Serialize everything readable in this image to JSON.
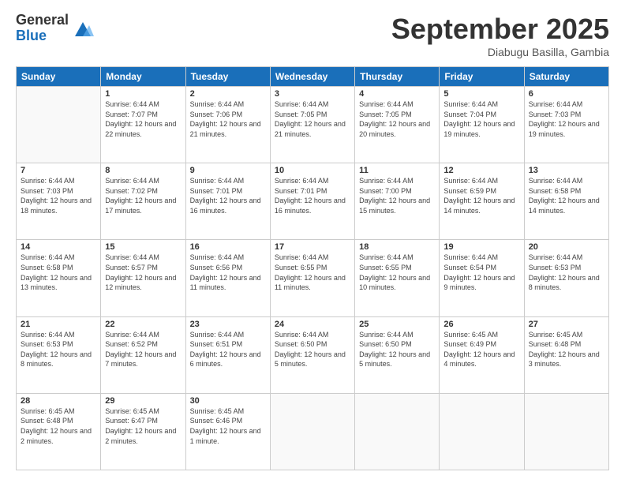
{
  "logo": {
    "general": "General",
    "blue": "Blue"
  },
  "header": {
    "month": "September 2025",
    "location": "Diabugu Basilla, Gambia"
  },
  "weekdays": [
    "Sunday",
    "Monday",
    "Tuesday",
    "Wednesday",
    "Thursday",
    "Friday",
    "Saturday"
  ],
  "weeks": [
    [
      {
        "day": "",
        "sunrise": "",
        "sunset": "",
        "daylight": ""
      },
      {
        "day": "1",
        "sunrise": "Sunrise: 6:44 AM",
        "sunset": "Sunset: 7:07 PM",
        "daylight": "Daylight: 12 hours and 22 minutes."
      },
      {
        "day": "2",
        "sunrise": "Sunrise: 6:44 AM",
        "sunset": "Sunset: 7:06 PM",
        "daylight": "Daylight: 12 hours and 21 minutes."
      },
      {
        "day": "3",
        "sunrise": "Sunrise: 6:44 AM",
        "sunset": "Sunset: 7:05 PM",
        "daylight": "Daylight: 12 hours and 21 minutes."
      },
      {
        "day": "4",
        "sunrise": "Sunrise: 6:44 AM",
        "sunset": "Sunset: 7:05 PM",
        "daylight": "Daylight: 12 hours and 20 minutes."
      },
      {
        "day": "5",
        "sunrise": "Sunrise: 6:44 AM",
        "sunset": "Sunset: 7:04 PM",
        "daylight": "Daylight: 12 hours and 19 minutes."
      },
      {
        "day": "6",
        "sunrise": "Sunrise: 6:44 AM",
        "sunset": "Sunset: 7:03 PM",
        "daylight": "Daylight: 12 hours and 19 minutes."
      }
    ],
    [
      {
        "day": "7",
        "sunrise": "Sunrise: 6:44 AM",
        "sunset": "Sunset: 7:03 PM",
        "daylight": "Daylight: 12 hours and 18 minutes."
      },
      {
        "day": "8",
        "sunrise": "Sunrise: 6:44 AM",
        "sunset": "Sunset: 7:02 PM",
        "daylight": "Daylight: 12 hours and 17 minutes."
      },
      {
        "day": "9",
        "sunrise": "Sunrise: 6:44 AM",
        "sunset": "Sunset: 7:01 PM",
        "daylight": "Daylight: 12 hours and 16 minutes."
      },
      {
        "day": "10",
        "sunrise": "Sunrise: 6:44 AM",
        "sunset": "Sunset: 7:01 PM",
        "daylight": "Daylight: 12 hours and 16 minutes."
      },
      {
        "day": "11",
        "sunrise": "Sunrise: 6:44 AM",
        "sunset": "Sunset: 7:00 PM",
        "daylight": "Daylight: 12 hours and 15 minutes."
      },
      {
        "day": "12",
        "sunrise": "Sunrise: 6:44 AM",
        "sunset": "Sunset: 6:59 PM",
        "daylight": "Daylight: 12 hours and 14 minutes."
      },
      {
        "day": "13",
        "sunrise": "Sunrise: 6:44 AM",
        "sunset": "Sunset: 6:58 PM",
        "daylight": "Daylight: 12 hours and 14 minutes."
      }
    ],
    [
      {
        "day": "14",
        "sunrise": "Sunrise: 6:44 AM",
        "sunset": "Sunset: 6:58 PM",
        "daylight": "Daylight: 12 hours and 13 minutes."
      },
      {
        "day": "15",
        "sunrise": "Sunrise: 6:44 AM",
        "sunset": "Sunset: 6:57 PM",
        "daylight": "Daylight: 12 hours and 12 minutes."
      },
      {
        "day": "16",
        "sunrise": "Sunrise: 6:44 AM",
        "sunset": "Sunset: 6:56 PM",
        "daylight": "Daylight: 12 hours and 11 minutes."
      },
      {
        "day": "17",
        "sunrise": "Sunrise: 6:44 AM",
        "sunset": "Sunset: 6:55 PM",
        "daylight": "Daylight: 12 hours and 11 minutes."
      },
      {
        "day": "18",
        "sunrise": "Sunrise: 6:44 AM",
        "sunset": "Sunset: 6:55 PM",
        "daylight": "Daylight: 12 hours and 10 minutes."
      },
      {
        "day": "19",
        "sunrise": "Sunrise: 6:44 AM",
        "sunset": "Sunset: 6:54 PM",
        "daylight": "Daylight: 12 hours and 9 minutes."
      },
      {
        "day": "20",
        "sunrise": "Sunrise: 6:44 AM",
        "sunset": "Sunset: 6:53 PM",
        "daylight": "Daylight: 12 hours and 8 minutes."
      }
    ],
    [
      {
        "day": "21",
        "sunrise": "Sunrise: 6:44 AM",
        "sunset": "Sunset: 6:53 PM",
        "daylight": "Daylight: 12 hours and 8 minutes."
      },
      {
        "day": "22",
        "sunrise": "Sunrise: 6:44 AM",
        "sunset": "Sunset: 6:52 PM",
        "daylight": "Daylight: 12 hours and 7 minutes."
      },
      {
        "day": "23",
        "sunrise": "Sunrise: 6:44 AM",
        "sunset": "Sunset: 6:51 PM",
        "daylight": "Daylight: 12 hours and 6 minutes."
      },
      {
        "day": "24",
        "sunrise": "Sunrise: 6:44 AM",
        "sunset": "Sunset: 6:50 PM",
        "daylight": "Daylight: 12 hours and 5 minutes."
      },
      {
        "day": "25",
        "sunrise": "Sunrise: 6:44 AM",
        "sunset": "Sunset: 6:50 PM",
        "daylight": "Daylight: 12 hours and 5 minutes."
      },
      {
        "day": "26",
        "sunrise": "Sunrise: 6:45 AM",
        "sunset": "Sunset: 6:49 PM",
        "daylight": "Daylight: 12 hours and 4 minutes."
      },
      {
        "day": "27",
        "sunrise": "Sunrise: 6:45 AM",
        "sunset": "Sunset: 6:48 PM",
        "daylight": "Daylight: 12 hours and 3 minutes."
      }
    ],
    [
      {
        "day": "28",
        "sunrise": "Sunrise: 6:45 AM",
        "sunset": "Sunset: 6:48 PM",
        "daylight": "Daylight: 12 hours and 2 minutes."
      },
      {
        "day": "29",
        "sunrise": "Sunrise: 6:45 AM",
        "sunset": "Sunset: 6:47 PM",
        "daylight": "Daylight: 12 hours and 2 minutes."
      },
      {
        "day": "30",
        "sunrise": "Sunrise: 6:45 AM",
        "sunset": "Sunset: 6:46 PM",
        "daylight": "Daylight: 12 hours and 1 minute."
      },
      {
        "day": "",
        "sunrise": "",
        "sunset": "",
        "daylight": ""
      },
      {
        "day": "",
        "sunrise": "",
        "sunset": "",
        "daylight": ""
      },
      {
        "day": "",
        "sunrise": "",
        "sunset": "",
        "daylight": ""
      },
      {
        "day": "",
        "sunrise": "",
        "sunset": "",
        "daylight": ""
      }
    ]
  ]
}
